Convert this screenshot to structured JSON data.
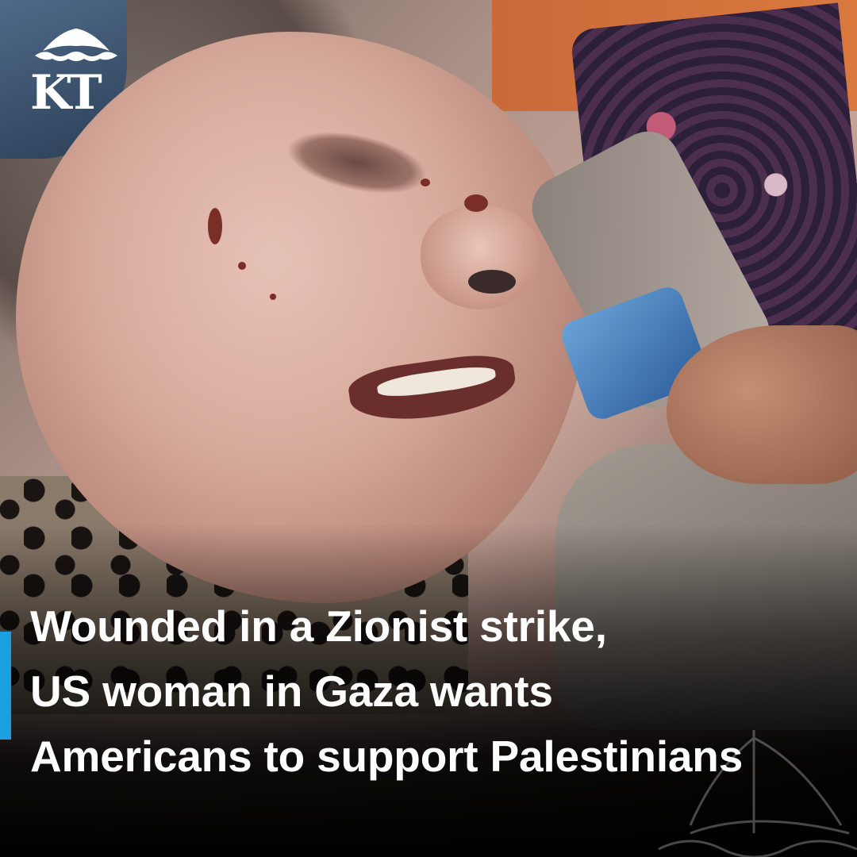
{
  "brand": {
    "logo_text": "KT",
    "accent_color": "#1aa0e0"
  },
  "headline": {
    "line1": "Wounded in a Zionist strike,",
    "line2": "US woman in Gaza wants",
    "line3": "Americans to support Palestinians"
  }
}
